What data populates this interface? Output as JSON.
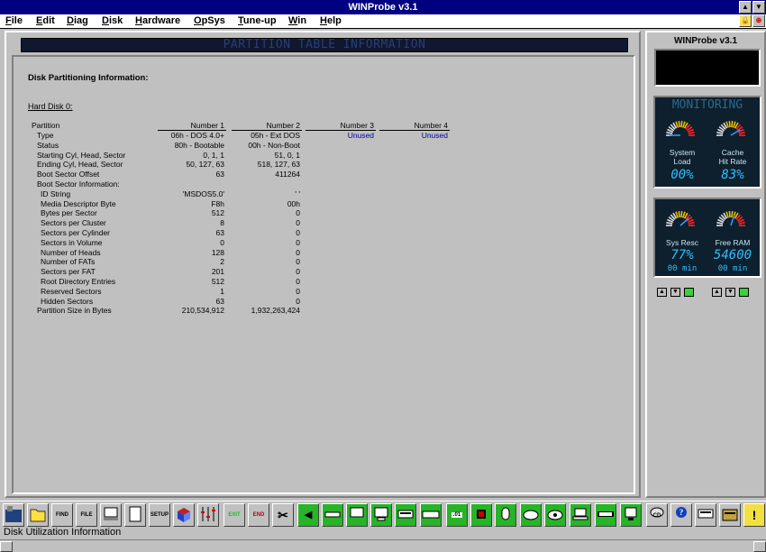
{
  "window": {
    "title": "WINProbe v3.1"
  },
  "menu": [
    "File",
    "Edit",
    "Diag",
    "Disk",
    "Hardware",
    "OpSys",
    "Tune-up",
    "Win",
    "Help"
  ],
  "banner": "PARTITION TABLE INFORMATION",
  "section_title": "Disk Partitioning Information:",
  "disk_label": "Hard Disk 0:",
  "table": {
    "columns": [
      "Partition",
      "Number 1",
      "Number 2",
      "Number 3",
      "Number 4"
    ],
    "rows": [
      {
        "label": "Type",
        "values": [
          "06h - DOS 4.0+",
          "05h - Ext DOS",
          "Unused",
          "Unused"
        ]
      },
      {
        "label": "Status",
        "values": [
          "80h - Bootable",
          "00h - Non-Boot",
          "",
          ""
        ]
      },
      {
        "label": "Starting Cyl, Head, Sector",
        "values": [
          "0, 1, 1",
          "51, 0, 1",
          "",
          ""
        ]
      },
      {
        "label": "Ending Cyl, Head, Sector",
        "values": [
          "50, 127, 63",
          "518, 127, 63",
          "",
          ""
        ]
      },
      {
        "label": "Boot Sector Offset",
        "values": [
          "63",
          "411264",
          "",
          ""
        ]
      },
      {
        "label": "Boot Sector Information:",
        "values": [
          "",
          "",
          "",
          ""
        ]
      },
      {
        "label": "ID String",
        "values": [
          "'MSDOS5.0'",
          "'      '",
          "",
          ""
        ]
      },
      {
        "label": "Media Descriptor Byte",
        "values": [
          "F8h",
          "00h",
          "",
          ""
        ]
      },
      {
        "label": "Bytes per Sector",
        "values": [
          "512",
          "0",
          "",
          ""
        ]
      },
      {
        "label": "Sectors per Cluster",
        "values": [
          "8",
          "0",
          "",
          ""
        ]
      },
      {
        "label": "Sectors per Cylinder",
        "values": [
          "63",
          "0",
          "",
          ""
        ]
      },
      {
        "label": "Sectors in Volume",
        "values": [
          "0",
          "0",
          "",
          ""
        ]
      },
      {
        "label": "Number of Heads",
        "values": [
          "128",
          "0",
          "",
          ""
        ]
      },
      {
        "label": "Number of FATs",
        "values": [
          "2",
          "0",
          "",
          ""
        ]
      },
      {
        "label": "Sectors per FAT",
        "values": [
          "201",
          "0",
          "",
          ""
        ]
      },
      {
        "label": "Root Directory Entries",
        "values": [
          "512",
          "0",
          "",
          ""
        ]
      },
      {
        "label": "Reserved Sectors",
        "values": [
          "1",
          "0",
          "",
          ""
        ]
      },
      {
        "label": "Hidden Sectors",
        "values": [
          "63",
          "0",
          "",
          ""
        ]
      },
      {
        "label": "Partition Size in Bytes",
        "values": [
          "210,534,912",
          "1,932,263,424",
          "",
          ""
        ]
      }
    ]
  },
  "right_panel": {
    "title": "WINProbe v3.1",
    "monitor1": {
      "header": "MONITORING",
      "gauges": [
        {
          "label1": "System",
          "label2": "Load",
          "value": "00%",
          "level": 0.0
        },
        {
          "label1": "Cache",
          "label2": "Hit Rate",
          "value": "83%",
          "level": 0.83
        }
      ]
    },
    "monitor2": {
      "gauges": [
        {
          "label": "Sys Resc",
          "value": "77%",
          "time": "00 min",
          "level": 0.77
        },
        {
          "label": "Free RAM",
          "value": "54600",
          "time": "00 min",
          "level": 0.6
        }
      ]
    }
  },
  "toolbar": {
    "find": "FIND",
    "file": "FILE",
    "setup": "SETUP",
    "exit": "EXIT",
    "end": "END",
    "cd": "CD",
    "num": ".01"
  },
  "status": "Disk Utilization Information",
  "colors": {
    "title_bar": "#000080",
    "value_blue": "#0000a0",
    "toolbar_green": "#28b428",
    "gauge_blue": "#30c0ff"
  }
}
